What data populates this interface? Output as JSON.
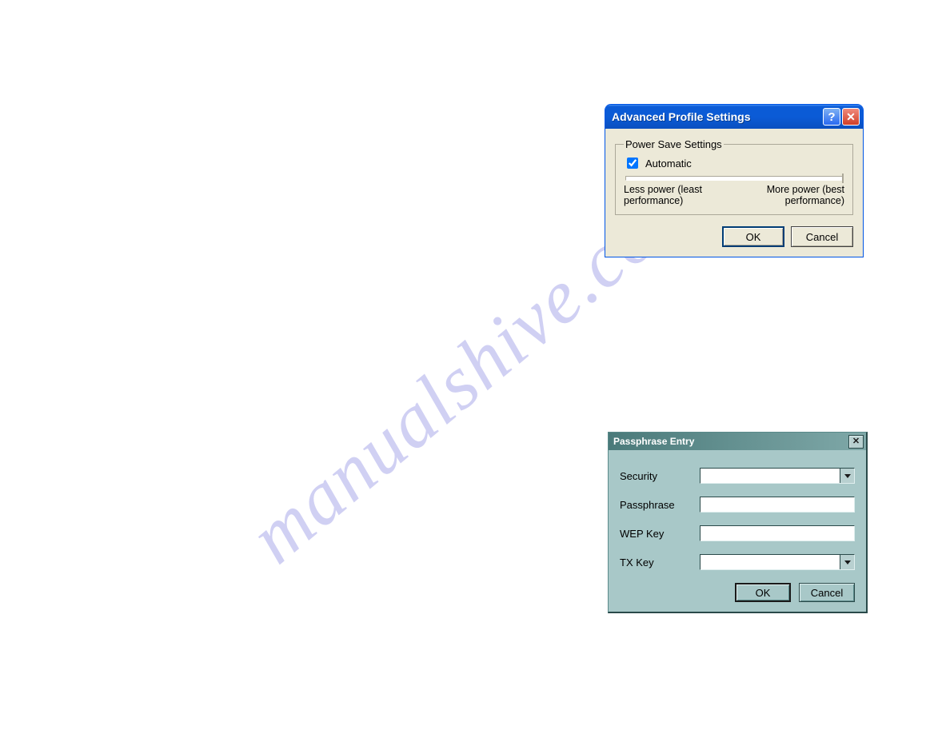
{
  "watermark": "manualshive.com",
  "dialog1": {
    "title": "Advanced Profile Settings",
    "group_legend": "Power Save Settings",
    "automatic_label": "Automatic",
    "automatic_checked": true,
    "slider_left_l1": "Less power (least",
    "slider_left_l2": "performance)",
    "slider_right_l1": "More power (best",
    "slider_right_l2": "performance)",
    "ok": "OK",
    "cancel": "Cancel"
  },
  "dialog2": {
    "title": "Passphrase Entry",
    "fields": {
      "security": "Security",
      "passphrase": "Passphrase",
      "wep_key": "WEP Key",
      "tx_key": "TX Key"
    },
    "values": {
      "security": "",
      "passphrase": "",
      "wep_key": "",
      "tx_key": ""
    },
    "ok": "OK",
    "cancel": "Cancel"
  }
}
